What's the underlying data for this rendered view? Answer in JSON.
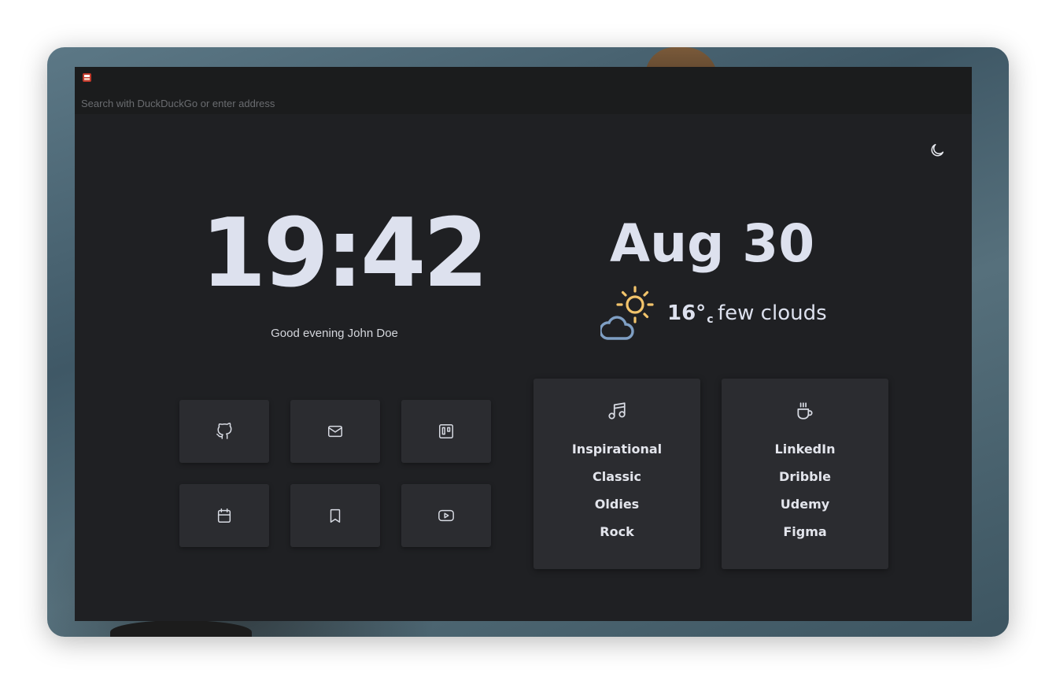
{
  "browser": {
    "address_placeholder": "Search with DuckDuckGo or enter address"
  },
  "icons": {
    "theme_toggle": "moon-icon",
    "weather": "sun-cloud-icon"
  },
  "clock": {
    "time": "19:42",
    "greeting": "Good evening John Doe"
  },
  "date": {
    "label": "Aug 30"
  },
  "weather": {
    "temperature": "16°",
    "unit": "c",
    "description": "few clouds"
  },
  "shortcuts": [
    {
      "icon": "github-icon"
    },
    {
      "icon": "mail-icon"
    },
    {
      "icon": "trello-icon"
    },
    {
      "icon": "calendar-icon"
    },
    {
      "icon": "bookmark-icon"
    },
    {
      "icon": "youtube-icon"
    }
  ],
  "cards": {
    "music": {
      "icon": "music-note-icon",
      "items": [
        "Inspirational",
        "Classic",
        "Oldies",
        "Rock"
      ]
    },
    "work": {
      "icon": "coffee-cup-icon",
      "items": [
        "LinkedIn",
        "Dribble",
        "Udemy",
        "Figma"
      ]
    }
  },
  "colors": {
    "background": "#1f2023",
    "tile": "#2b2c30",
    "text": "#dde1ee",
    "sun": "#f2c46b",
    "cloud": "#7f9fc4"
  }
}
